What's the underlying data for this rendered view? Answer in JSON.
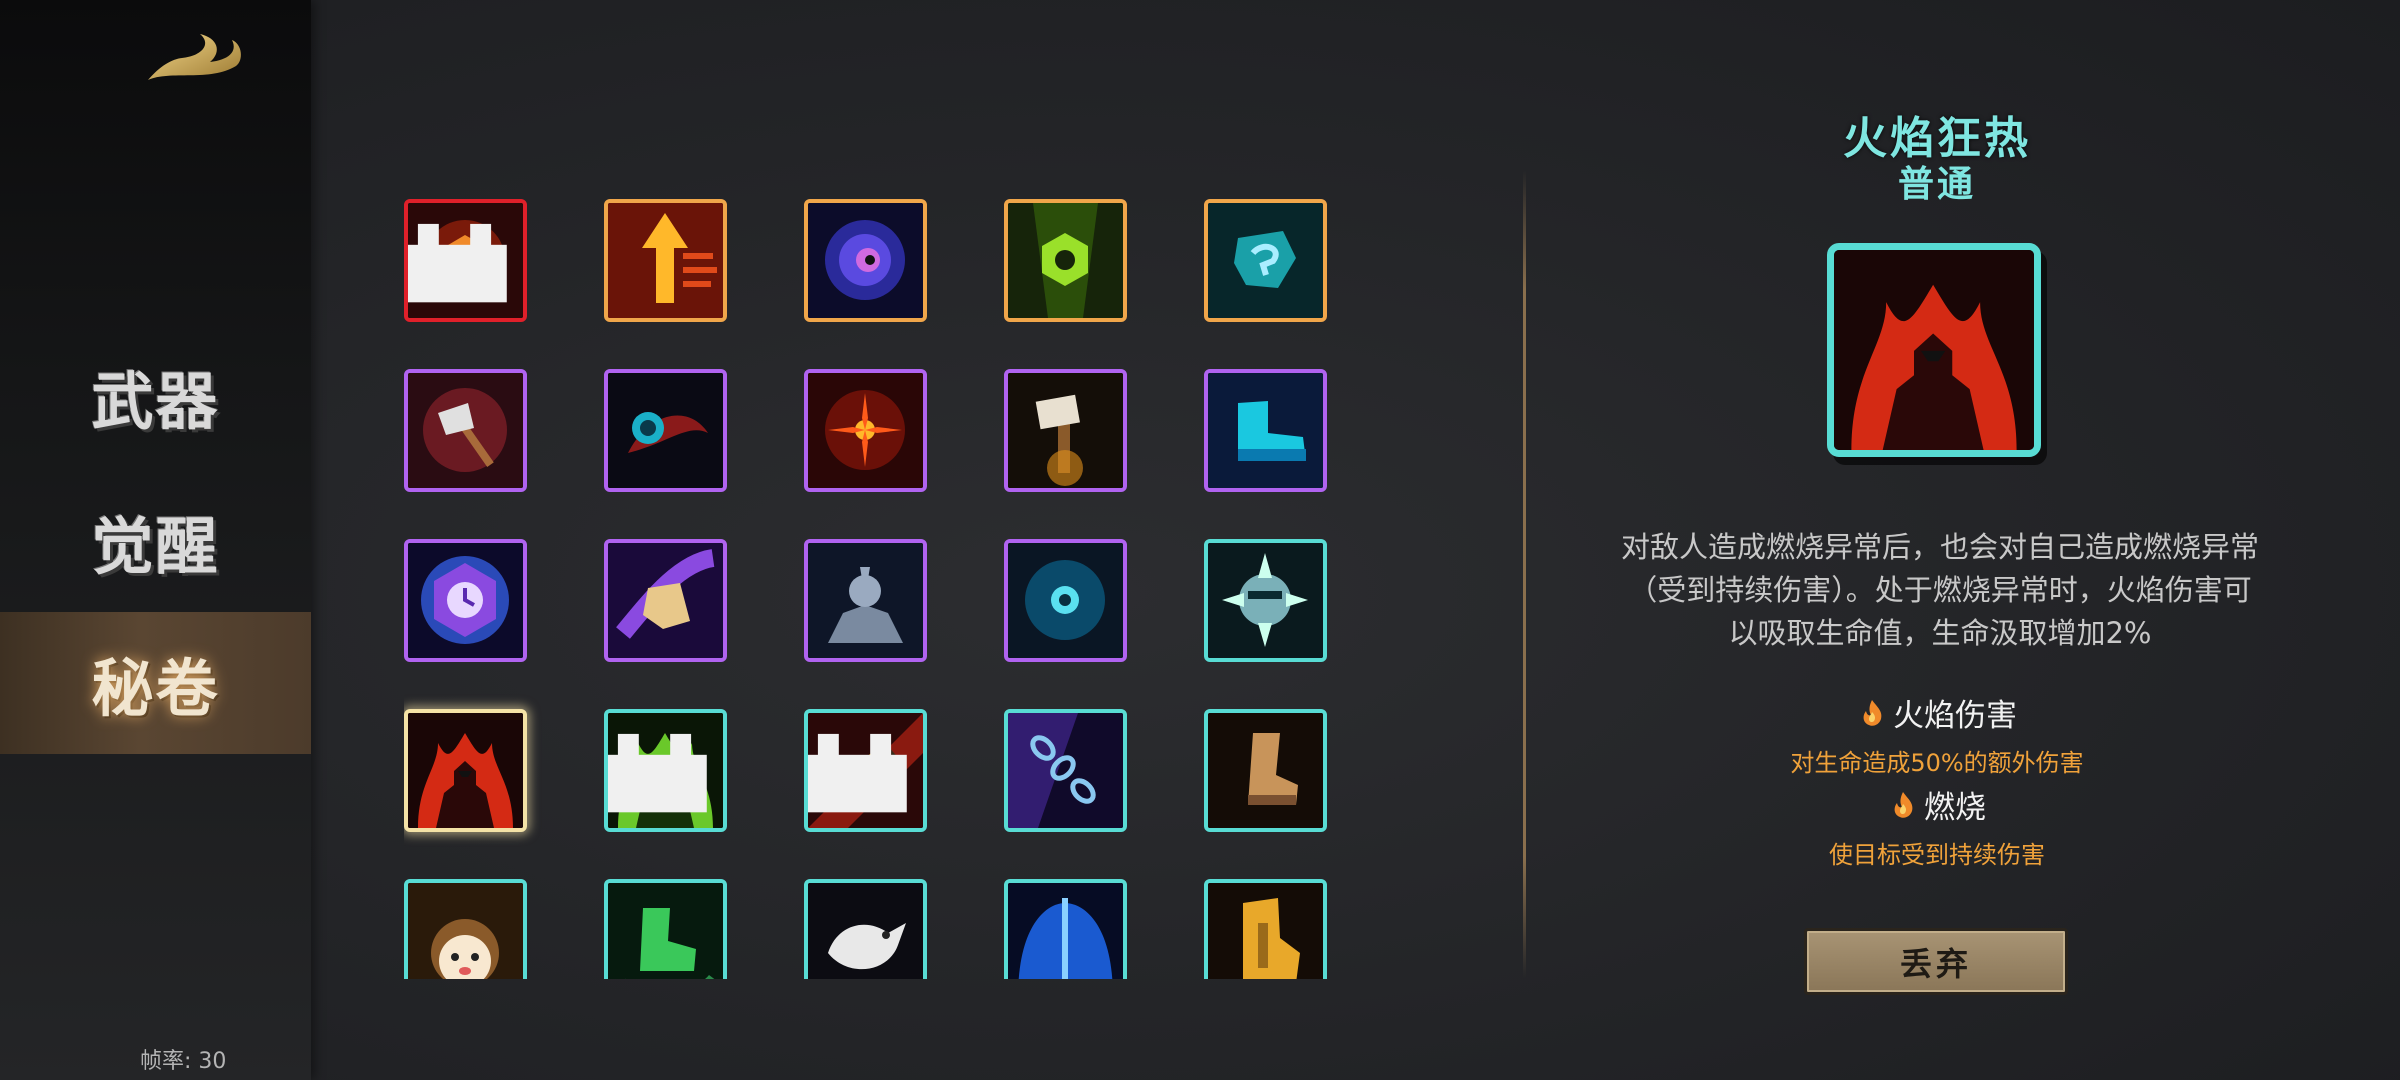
{
  "sidebar": {
    "logo_icon": "golden-swoosh-logo",
    "items": [
      {
        "label": "武器",
        "selected": false
      },
      {
        "label": "觉醒",
        "selected": false
      },
      {
        "label": "秘卷",
        "selected": true
      }
    ],
    "fps_label": "帧率: 30"
  },
  "grid": {
    "rarity_colors": {
      "red": "#e0202a",
      "orange": "#f0a64a",
      "purple": "#b063f0",
      "teal": "#58dcd4",
      "selected": "#f4e2a6"
    },
    "rows": [
      [
        {
          "icon": "flaming-shield-icon",
          "rarity": "red",
          "locked": true
        },
        {
          "icon": "fire-arrow-up-icon",
          "rarity": "orange"
        },
        {
          "icon": "blue-vortex-icon",
          "rarity": "orange"
        },
        {
          "icon": "green-hex-nut-icon",
          "rarity": "orange"
        },
        {
          "icon": "teal-rune-icon",
          "rarity": "orange"
        }
      ],
      [
        {
          "icon": "battle-axe-icon",
          "rarity": "purple"
        },
        {
          "icon": "dark-orb-icon",
          "rarity": "purple"
        },
        {
          "icon": "red-sun-icon",
          "rarity": "purple"
        },
        {
          "icon": "hammer-icon",
          "rarity": "purple"
        },
        {
          "icon": "ice-boot-icon",
          "rarity": "purple"
        }
      ],
      [
        {
          "icon": "purple-clock-icon",
          "rarity": "purple"
        },
        {
          "icon": "gold-bag-icon",
          "rarity": "purple"
        },
        {
          "icon": "stone-warrior-icon",
          "rarity": "purple"
        },
        {
          "icon": "blue-eye-vortex-icon",
          "rarity": "purple"
        },
        {
          "icon": "spiked-ball-icon",
          "rarity": "teal"
        }
      ],
      [
        {
          "icon": "fire-warrior-silhouette-icon",
          "rarity": "teal",
          "selected": true
        },
        {
          "icon": "poison-warrior-silhouette-icon",
          "rarity": "teal",
          "locked": true
        },
        {
          "icon": "golden-sword-icon",
          "rarity": "teal",
          "locked": true
        },
        {
          "icon": "chain-icon",
          "rarity": "teal"
        },
        {
          "icon": "leather-boot-icon",
          "rarity": "teal"
        }
      ],
      [
        {
          "icon": "cute-face-icon",
          "rarity": "teal"
        },
        {
          "icon": "green-boot-icon",
          "rarity": "teal"
        },
        {
          "icon": "white-bird-icon",
          "rarity": "teal"
        },
        {
          "icon": "blue-shield-icon",
          "rarity": "teal"
        },
        {
          "icon": "gold-boot-icon",
          "rarity": "teal"
        }
      ]
    ]
  },
  "detail": {
    "title": "火焰狂热",
    "rarity": "普通",
    "icon": "fire-warrior-silhouette-icon",
    "description": "对敌人造成燃烧异常后，也会对自己造成燃烧异常（受到持续伤害）。处于燃烧异常时，火焰伤害可以吸取生命值，生命汲取增加2%",
    "tags": [
      {
        "icon": "flame-icon",
        "name": "火焰伤害",
        "desc": "对生命造成50%的额外伤害"
      },
      {
        "icon": "flame-icon",
        "name": "燃烧",
        "desc": "使目标受到持续伤害"
      }
    ],
    "discard_label": "丢弃"
  }
}
